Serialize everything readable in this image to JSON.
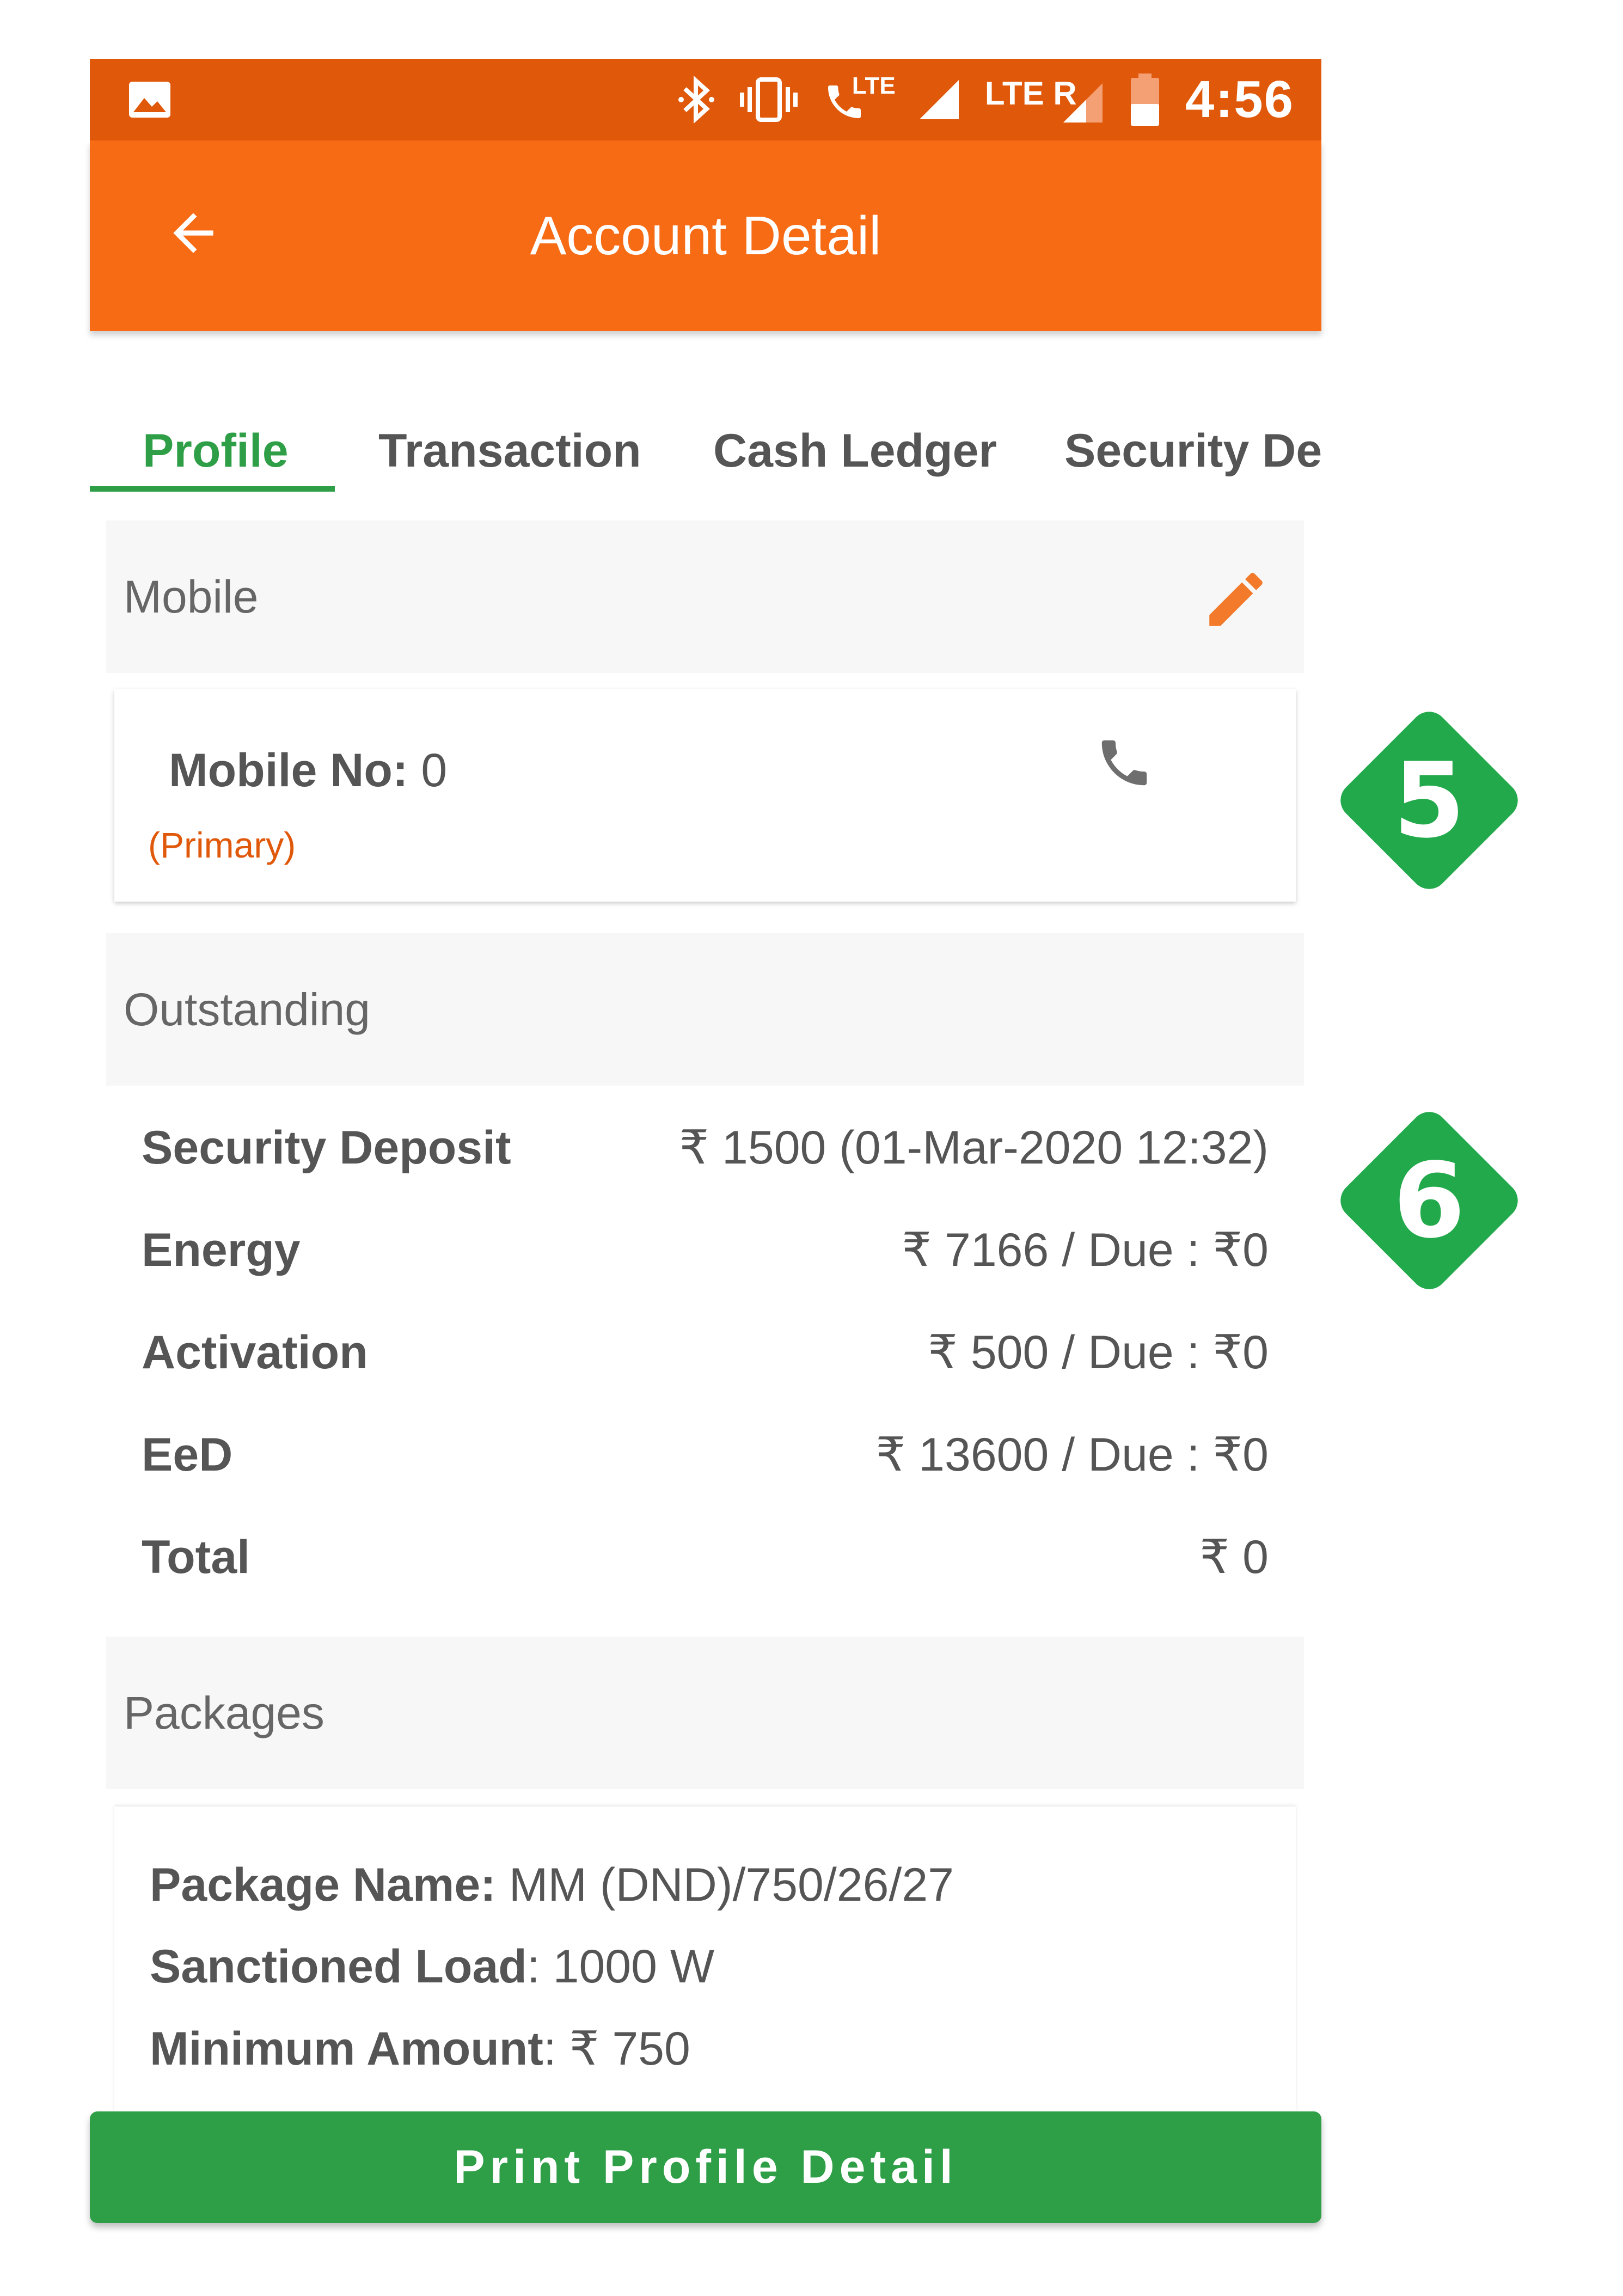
{
  "status_bar": {
    "time": "4:56",
    "network_label": "LTE",
    "roaming_label": "LTE R"
  },
  "app_bar": {
    "title": "Account Detail"
  },
  "tabs": [
    {
      "label": "Profile",
      "active": true
    },
    {
      "label": "Transaction",
      "active": false
    },
    {
      "label": "Cash Ledger",
      "active": false
    },
    {
      "label": "Security Dep",
      "active": false
    }
  ],
  "mobile_section": {
    "header": "Mobile",
    "number_label": "Mobile No:",
    "number_value": "0",
    "tag": "(Primary)"
  },
  "outstanding_section": {
    "header": "Outstanding",
    "rows": [
      {
        "label": "Security Deposit",
        "value": "₹ 1500 (01-Mar-2020 12:32)"
      },
      {
        "label": "Energy",
        "value": "₹ 7166 / Due : ₹0"
      },
      {
        "label": "Activation",
        "value": "₹ 500 / Due : ₹0"
      },
      {
        "label": "EeD",
        "value": "₹ 13600 / Due : ₹0"
      },
      {
        "label": "Total",
        "value": "₹ 0"
      }
    ]
  },
  "packages_section": {
    "header": "Packages",
    "package_name_label": "Package Name:",
    "package_name_value": "MM (DND)/750/26/27",
    "sanctioned_load_label": "Sanctioned Load",
    "sanctioned_load_value": ": 1000 W",
    "minimum_amount_label": "Minimum Amount",
    "minimum_amount_value": ": ₹ 750"
  },
  "print_button": {
    "label": "Print Profile Detail"
  },
  "callouts": [
    {
      "number": "5"
    },
    {
      "number": "6"
    }
  ],
  "colors": {
    "status_bar": "#E0580A",
    "app_bar": "#F76B15",
    "accent_green": "#2E9E47",
    "callout_green": "#22A94B"
  },
  "icons": {
    "gallery": "image-icon",
    "bluetooth": "bluetooth-icon",
    "vibrate": "vibrate-icon",
    "call_lte": "call-lte-icon",
    "signal": "signal-icon",
    "battery": "battery-icon",
    "back": "arrow-back-icon",
    "edit": "pencil-icon",
    "call": "phone-icon"
  }
}
